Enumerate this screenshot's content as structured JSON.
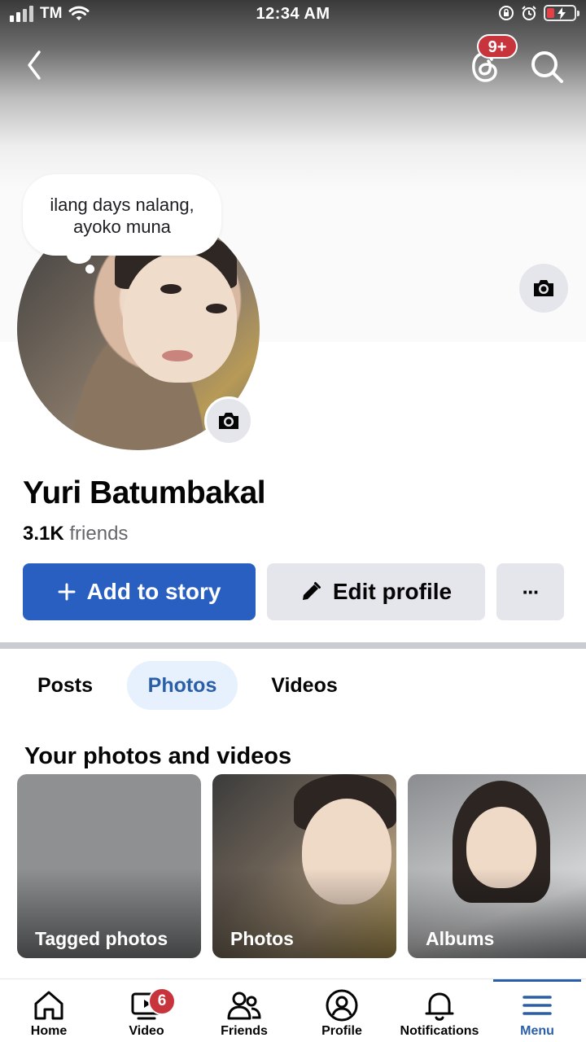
{
  "status_bar": {
    "carrier": "TM",
    "time": "12:34 AM"
  },
  "header": {
    "notification_badge": "9+"
  },
  "profile": {
    "thought_bubble": "ilang days nalang,\nayoko muna",
    "name": "Yuri Batumbakal",
    "friends_count": "3.1K",
    "friends_label": "friends"
  },
  "actions": {
    "add_to_story": "Add to story",
    "edit_profile": "Edit profile",
    "more": "···"
  },
  "tabs": [
    {
      "label": "Posts",
      "active": false
    },
    {
      "label": "Photos",
      "active": true
    },
    {
      "label": "Videos",
      "active": false
    }
  ],
  "section": {
    "title": "Your photos and videos"
  },
  "photo_cards": [
    {
      "label": "Tagged photos"
    },
    {
      "label": "Photos"
    },
    {
      "label": "Albums"
    }
  ],
  "bottom_nav": {
    "items": [
      {
        "label": "Home",
        "icon": "home-icon"
      },
      {
        "label": "Video",
        "icon": "video-icon",
        "badge": "6"
      },
      {
        "label": "Friends",
        "icon": "friends-icon"
      },
      {
        "label": "Profile",
        "icon": "profile-icon"
      },
      {
        "label": "Notifications",
        "icon": "bell-icon"
      },
      {
        "label": "Menu",
        "icon": "menu-icon",
        "active": true
      }
    ]
  },
  "colors": {
    "primary": "#2a5fc2",
    "tab_active_text": "#2a5fa8",
    "badge": "#c8343c",
    "secondary_button": "#e4e6eb"
  }
}
